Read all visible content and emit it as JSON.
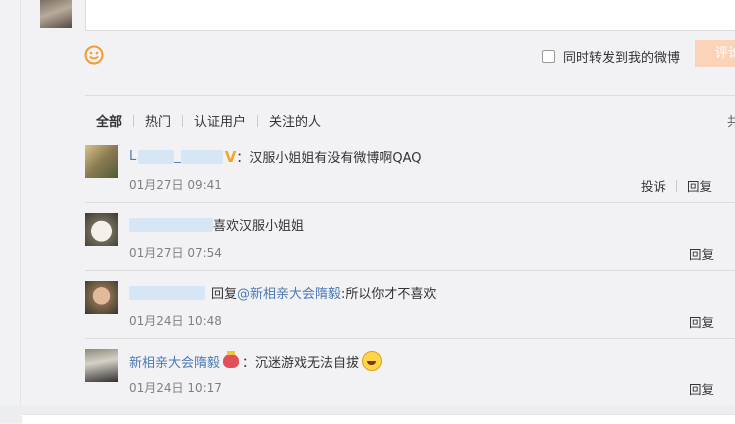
{
  "repost": {
    "label": "同时转发到我的微博"
  },
  "submit": {
    "label": "评论"
  },
  "tabs": [
    "全部",
    "热门",
    "认证用户",
    "关注的人"
  ],
  "tabs_right": "共",
  "comments": [
    {
      "user_visible": "L",
      "user_suffix": "_",
      "text": "汉服小姐姐有没有微博啊QAQ",
      "time": "01月27日 09:41",
      "report": "投诉",
      "reply": "回复"
    },
    {
      "text": "喜欢汉服小姐姐",
      "time": "01月27日 07:54",
      "reply": "回复"
    },
    {
      "reply_prefix": "回复",
      "mention": "@新相亲大会隋毅",
      "text": ":所以你才不喜欢",
      "time": "01月24日 10:48",
      "reply": "回复"
    },
    {
      "user": "新相亲大会隋毅",
      "text": "沉迷游戏无法自拔",
      "time": "01月24日 10:17",
      "reply": "回复"
    }
  ],
  "icons": {
    "smile": "smile-icon",
    "verified": "verified-v-icon",
    "crown": "crown-icon",
    "laugh": "laugh-emoji-icon"
  },
  "colors": {
    "link": "#4a79b4",
    "submit": "#fbd3b9",
    "verified": "#f5a623"
  }
}
